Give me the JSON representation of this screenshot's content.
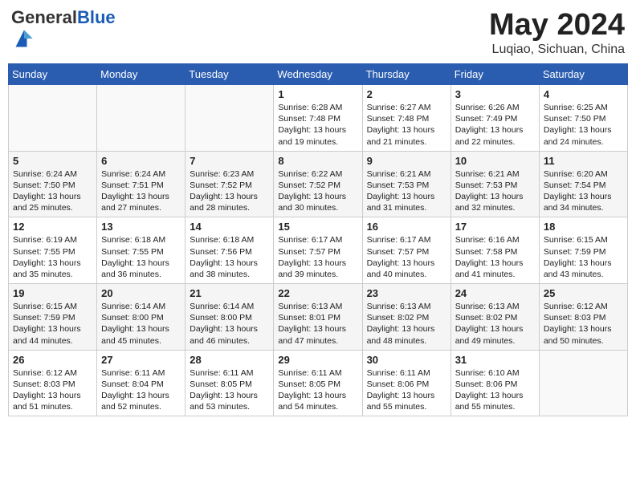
{
  "header": {
    "logo_general": "General",
    "logo_blue": "Blue",
    "title": "May 2024",
    "subtitle": "Luqiao, Sichuan, China"
  },
  "days_of_week": [
    "Sunday",
    "Monday",
    "Tuesday",
    "Wednesday",
    "Thursday",
    "Friday",
    "Saturday"
  ],
  "weeks": [
    [
      {
        "num": "",
        "info": ""
      },
      {
        "num": "",
        "info": ""
      },
      {
        "num": "",
        "info": ""
      },
      {
        "num": "1",
        "info": "Sunrise: 6:28 AM\nSunset: 7:48 PM\nDaylight: 13 hours\nand 19 minutes."
      },
      {
        "num": "2",
        "info": "Sunrise: 6:27 AM\nSunset: 7:48 PM\nDaylight: 13 hours\nand 21 minutes."
      },
      {
        "num": "3",
        "info": "Sunrise: 6:26 AM\nSunset: 7:49 PM\nDaylight: 13 hours\nand 22 minutes."
      },
      {
        "num": "4",
        "info": "Sunrise: 6:25 AM\nSunset: 7:50 PM\nDaylight: 13 hours\nand 24 minutes."
      }
    ],
    [
      {
        "num": "5",
        "info": "Sunrise: 6:24 AM\nSunset: 7:50 PM\nDaylight: 13 hours\nand 25 minutes."
      },
      {
        "num": "6",
        "info": "Sunrise: 6:24 AM\nSunset: 7:51 PM\nDaylight: 13 hours\nand 27 minutes."
      },
      {
        "num": "7",
        "info": "Sunrise: 6:23 AM\nSunset: 7:52 PM\nDaylight: 13 hours\nand 28 minutes."
      },
      {
        "num": "8",
        "info": "Sunrise: 6:22 AM\nSunset: 7:52 PM\nDaylight: 13 hours\nand 30 minutes."
      },
      {
        "num": "9",
        "info": "Sunrise: 6:21 AM\nSunset: 7:53 PM\nDaylight: 13 hours\nand 31 minutes."
      },
      {
        "num": "10",
        "info": "Sunrise: 6:21 AM\nSunset: 7:53 PM\nDaylight: 13 hours\nand 32 minutes."
      },
      {
        "num": "11",
        "info": "Sunrise: 6:20 AM\nSunset: 7:54 PM\nDaylight: 13 hours\nand 34 minutes."
      }
    ],
    [
      {
        "num": "12",
        "info": "Sunrise: 6:19 AM\nSunset: 7:55 PM\nDaylight: 13 hours\nand 35 minutes."
      },
      {
        "num": "13",
        "info": "Sunrise: 6:18 AM\nSunset: 7:55 PM\nDaylight: 13 hours\nand 36 minutes."
      },
      {
        "num": "14",
        "info": "Sunrise: 6:18 AM\nSunset: 7:56 PM\nDaylight: 13 hours\nand 38 minutes."
      },
      {
        "num": "15",
        "info": "Sunrise: 6:17 AM\nSunset: 7:57 PM\nDaylight: 13 hours\nand 39 minutes."
      },
      {
        "num": "16",
        "info": "Sunrise: 6:17 AM\nSunset: 7:57 PM\nDaylight: 13 hours\nand 40 minutes."
      },
      {
        "num": "17",
        "info": "Sunrise: 6:16 AM\nSunset: 7:58 PM\nDaylight: 13 hours\nand 41 minutes."
      },
      {
        "num": "18",
        "info": "Sunrise: 6:15 AM\nSunset: 7:59 PM\nDaylight: 13 hours\nand 43 minutes."
      }
    ],
    [
      {
        "num": "19",
        "info": "Sunrise: 6:15 AM\nSunset: 7:59 PM\nDaylight: 13 hours\nand 44 minutes."
      },
      {
        "num": "20",
        "info": "Sunrise: 6:14 AM\nSunset: 8:00 PM\nDaylight: 13 hours\nand 45 minutes."
      },
      {
        "num": "21",
        "info": "Sunrise: 6:14 AM\nSunset: 8:00 PM\nDaylight: 13 hours\nand 46 minutes."
      },
      {
        "num": "22",
        "info": "Sunrise: 6:13 AM\nSunset: 8:01 PM\nDaylight: 13 hours\nand 47 minutes."
      },
      {
        "num": "23",
        "info": "Sunrise: 6:13 AM\nSunset: 8:02 PM\nDaylight: 13 hours\nand 48 minutes."
      },
      {
        "num": "24",
        "info": "Sunrise: 6:13 AM\nSunset: 8:02 PM\nDaylight: 13 hours\nand 49 minutes."
      },
      {
        "num": "25",
        "info": "Sunrise: 6:12 AM\nSunset: 8:03 PM\nDaylight: 13 hours\nand 50 minutes."
      }
    ],
    [
      {
        "num": "26",
        "info": "Sunrise: 6:12 AM\nSunset: 8:03 PM\nDaylight: 13 hours\nand 51 minutes."
      },
      {
        "num": "27",
        "info": "Sunrise: 6:11 AM\nSunset: 8:04 PM\nDaylight: 13 hours\nand 52 minutes."
      },
      {
        "num": "28",
        "info": "Sunrise: 6:11 AM\nSunset: 8:05 PM\nDaylight: 13 hours\nand 53 minutes."
      },
      {
        "num": "29",
        "info": "Sunrise: 6:11 AM\nSunset: 8:05 PM\nDaylight: 13 hours\nand 54 minutes."
      },
      {
        "num": "30",
        "info": "Sunrise: 6:11 AM\nSunset: 8:06 PM\nDaylight: 13 hours\nand 55 minutes."
      },
      {
        "num": "31",
        "info": "Sunrise: 6:10 AM\nSunset: 8:06 PM\nDaylight: 13 hours\nand 55 minutes."
      },
      {
        "num": "",
        "info": ""
      }
    ]
  ]
}
